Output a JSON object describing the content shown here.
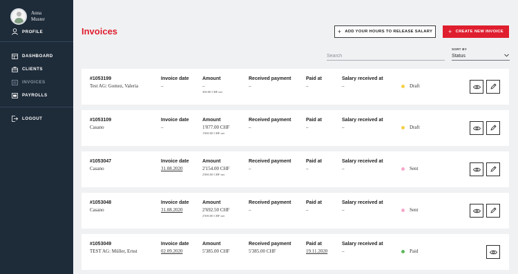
{
  "sidebar": {
    "user_name": "Anna Muster",
    "profile_label": "PROFILE",
    "items": [
      {
        "label": "DASHBOARD",
        "icon": "dashboard-icon"
      },
      {
        "label": "CLIENTS",
        "icon": "briefcase-icon"
      },
      {
        "label": "INVOICES",
        "icon": "invoice-icon"
      },
      {
        "label": "PAYROLLS",
        "icon": "payroll-icon"
      }
    ],
    "logout_label": "LOGOUT"
  },
  "header": {
    "title": "Invoices",
    "hours_button": "ADD YOUR HOURS TO RELEASE SALARY",
    "create_button": "CREATE NEW INVOICE"
  },
  "filters": {
    "search_placeholder": "Search",
    "sort_label": "SORT BY",
    "sort_value": "Status"
  },
  "labels": {
    "invoice_date": "Invoice date",
    "amount": "Amount",
    "received_payment": "Received payment",
    "paid_at": "Paid at",
    "salary_received_at": "Salary received at"
  },
  "colors": {
    "accent": "#df1e2e",
    "sidebar_bg": "#1e2b39",
    "draft": "#f5cf47",
    "sent": "#f5a8cb",
    "paid": "#5cb85c"
  },
  "invoices": [
    {
      "number": "#1053199",
      "client": "Test AG: Gomez, Valeria",
      "invoice_date": "–",
      "amount": "–",
      "amount_net": "300.00 CHF net",
      "received_payment": "–",
      "paid_at": "–",
      "salary_received_at": "–",
      "status": "Draft"
    },
    {
      "number": "#1053109",
      "client": "Casano",
      "invoice_date": "–",
      "amount": "1'077.00 CHF",
      "amount_net": "1'000.00 CHF net",
      "received_payment": "–",
      "paid_at": "–",
      "salary_received_at": "–",
      "status": "Draft"
    },
    {
      "number": "#1053047",
      "client": "Casano",
      "invoice_date": "31.08.2020",
      "amount": "2'154.00 CHF",
      "amount_net": "2'000.00 CHF net",
      "received_payment": "–",
      "paid_at": "–",
      "salary_received_at": "–",
      "status": "Sent"
    },
    {
      "number": "#1053048",
      "client": "Casano",
      "invoice_date": "31.08.2020",
      "amount": "2'692.50 CHF",
      "amount_net": "2'500.00 CHF net",
      "received_payment": "–",
      "paid_at": "–",
      "salary_received_at": "–",
      "status": "Sent"
    },
    {
      "number": "#1053049",
      "client": "TEST AG: Müller, Ernst",
      "invoice_date": "02.09.2020",
      "amount": "5'385.00 CHF",
      "amount_net": "",
      "received_payment": "5'385.00 CHF",
      "paid_at": "19.11.2020",
      "salary_received_at": "–",
      "status": "Paid"
    }
  ]
}
